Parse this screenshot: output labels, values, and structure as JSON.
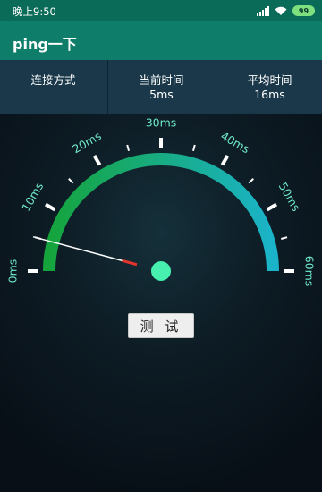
{
  "status_bar": {
    "time": "晚上9:50",
    "battery": "99",
    "icons": [
      "signal-icon",
      "wifi-icon",
      "battery-icon"
    ]
  },
  "app_bar": {
    "title": "ping一下"
  },
  "stats": [
    {
      "label": "连接方式",
      "value": ""
    },
    {
      "label": "当前时间",
      "value": "5ms"
    },
    {
      "label": "平均时间",
      "value": "16ms"
    }
  ],
  "gauge": {
    "labels": [
      "0ms",
      "10ms",
      "20ms",
      "30ms",
      "40ms",
      "50ms",
      "60ms"
    ],
    "min": 0,
    "max": 60,
    "current_value": 5,
    "colors": {
      "arc_start": "#15a43c",
      "arc_end": "#1bb3c9",
      "label": "#6fe9c8",
      "needle": "#ffffff",
      "needle_tip": "#e0342c",
      "hub": "#48f0b0"
    }
  },
  "button": {
    "label": "测 试"
  }
}
